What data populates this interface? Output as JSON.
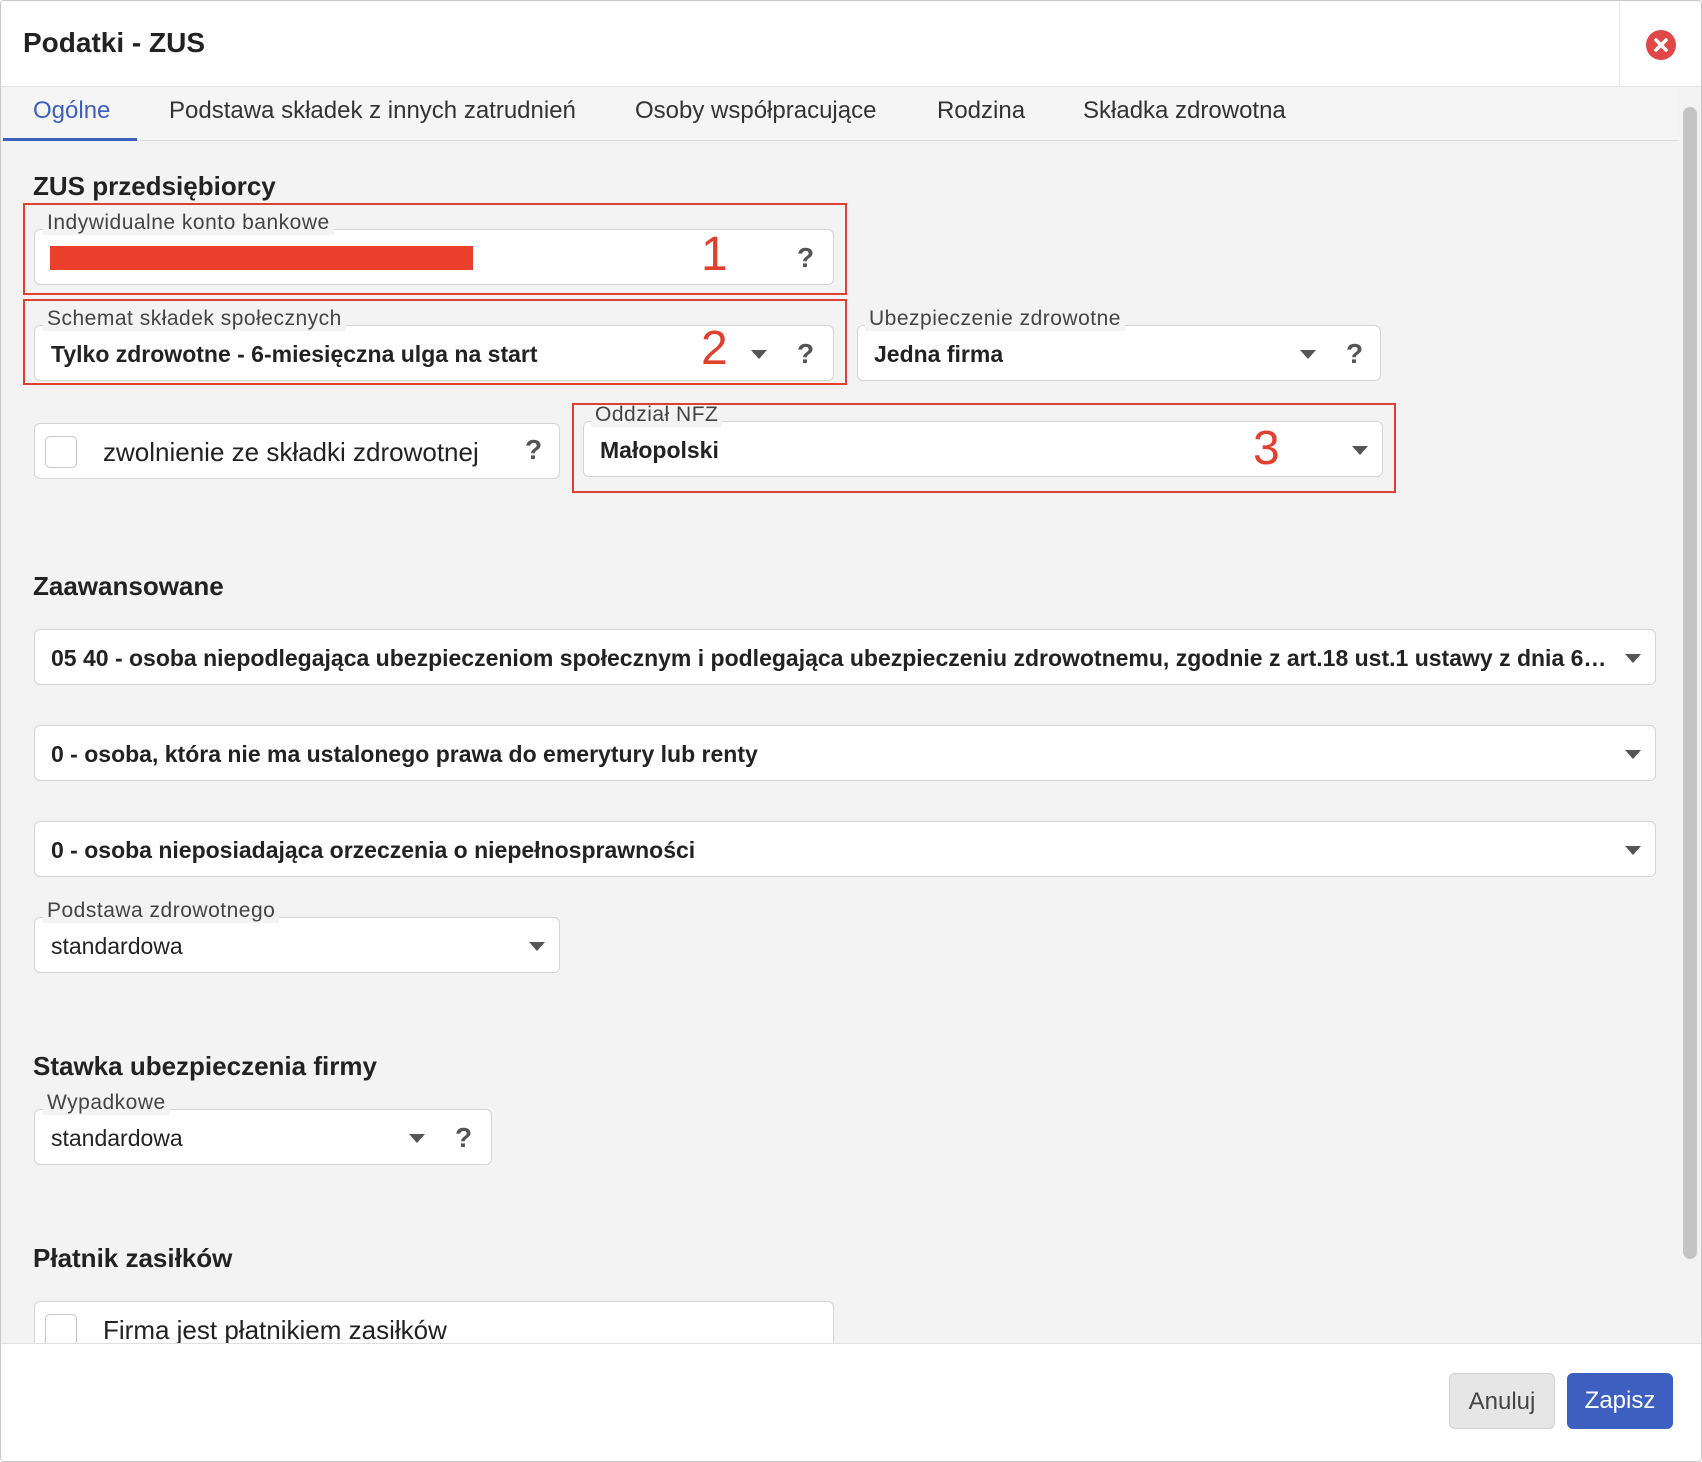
{
  "dialog": {
    "title": "Podatki - ZUS"
  },
  "tabs": [
    {
      "label": "Ogólne",
      "active": true
    },
    {
      "label": "Podstawa składek z innych zatrudnień",
      "active": false
    },
    {
      "label": "Osoby współpracujące",
      "active": false
    },
    {
      "label": "Rodzina",
      "active": false
    },
    {
      "label": "Składka zdrowotna",
      "active": false
    }
  ],
  "zus": {
    "section_title": "ZUS przedsiębiorcy",
    "bank_account": {
      "label": "Indywidualne konto bankowe",
      "value": "",
      "redacted": true
    },
    "contrib_scheme": {
      "label": "Schemat składek społecznych",
      "value": "Tylko zdrowotne - 6-miesięczna ulga na start"
    },
    "health_insurance": {
      "label": "Ubezpieczenie zdrowotne",
      "value": "Jedna firma"
    },
    "exemption": {
      "label": "zwolnienie ze składki zdrowotnej",
      "checked": false
    },
    "nfz_branch": {
      "label": "Oddział NFZ",
      "value": "Małopolski"
    }
  },
  "annotations": [
    "1",
    "2",
    "3"
  ],
  "advanced": {
    "section_title": "Zaawansowane",
    "insurance_code": "05 40 - osoba niepodlegająca ubezpieczeniom społecznym i podlegająca ubezpieczeniu zdrowotnemu, zgodnie z art.18 ust.1 ustawy z dnia 6 m…",
    "pension_right": "0 - osoba, która nie ma ustalonego prawa do emerytury lub renty",
    "disability": "0 - osoba nieposiadająca orzeczenia o niepełnosprawności",
    "health_basis": {
      "label": "Podstawa zdrowotnego",
      "value": "standardowa"
    }
  },
  "company_rate": {
    "section_title": "Stawka ubezpieczenia firmy",
    "accident": {
      "label": "Wypadkowe",
      "value": "standardowa"
    }
  },
  "benefit_payer": {
    "section_title": "Płatnik zasiłków",
    "checkbox_label": "Firma jest płatnikiem zasiłków",
    "checked": false
  },
  "footer": {
    "cancel_label": "Anuluj",
    "save_label": "Zapisz"
  },
  "icons": {
    "close": "close-icon",
    "help": "question-mark",
    "dropdown": "chevron-down-icon"
  },
  "colors": {
    "accent": "#3d5fbf",
    "annotation": "#e04030",
    "close": "#e04848"
  },
  "help_glyph": "?"
}
